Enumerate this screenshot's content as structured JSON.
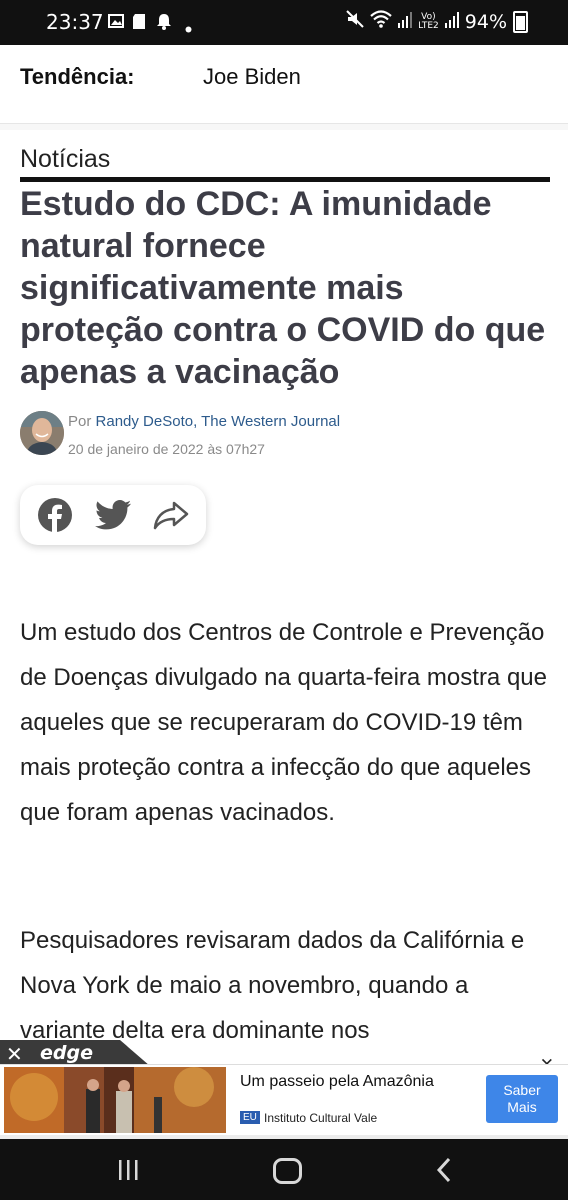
{
  "status_bar": {
    "time": "23:37",
    "network": "LTE2",
    "battery": "94%"
  },
  "trend": {
    "label": "Tendência:",
    "value": "Joe Biden"
  },
  "article": {
    "section": "Notícias",
    "headline": "Estudo do CDC: A imunidade natural fornece significativamente mais proteção contra o COVID do que apenas a vacinação",
    "by_prefix": "Por",
    "author": "Randy DeSoto, The Western Journal",
    "date": "20 de janeiro de 2022 às 07h27",
    "share_icons": [
      "facebook-icon",
      "twitter-icon",
      "share-icon"
    ],
    "paragraphs": [
      "Um estudo dos Centros de Controle e Prevenção de Doenças divulgado na quarta-feira mostra que aqueles que se recuperaram do COVID-19 têm mais proteção contra a infecção do que aqueles que foram apenas vacinados.",
      "Pesquisadores revisaram dados da Califórnia e Nova York de maio a novembro, quando a variante delta era dominante nos"
    ]
  },
  "ad": {
    "network_logo": "edge",
    "title": "Um passeio pela Amazônia",
    "badge": "EU",
    "source": "Instituto Cultural Vale",
    "button_label": "Saber Mais",
    "button_color": "#3e86e8"
  },
  "colors": {
    "headline": "#3d3d47",
    "author_link": "#2d5b8c"
  }
}
